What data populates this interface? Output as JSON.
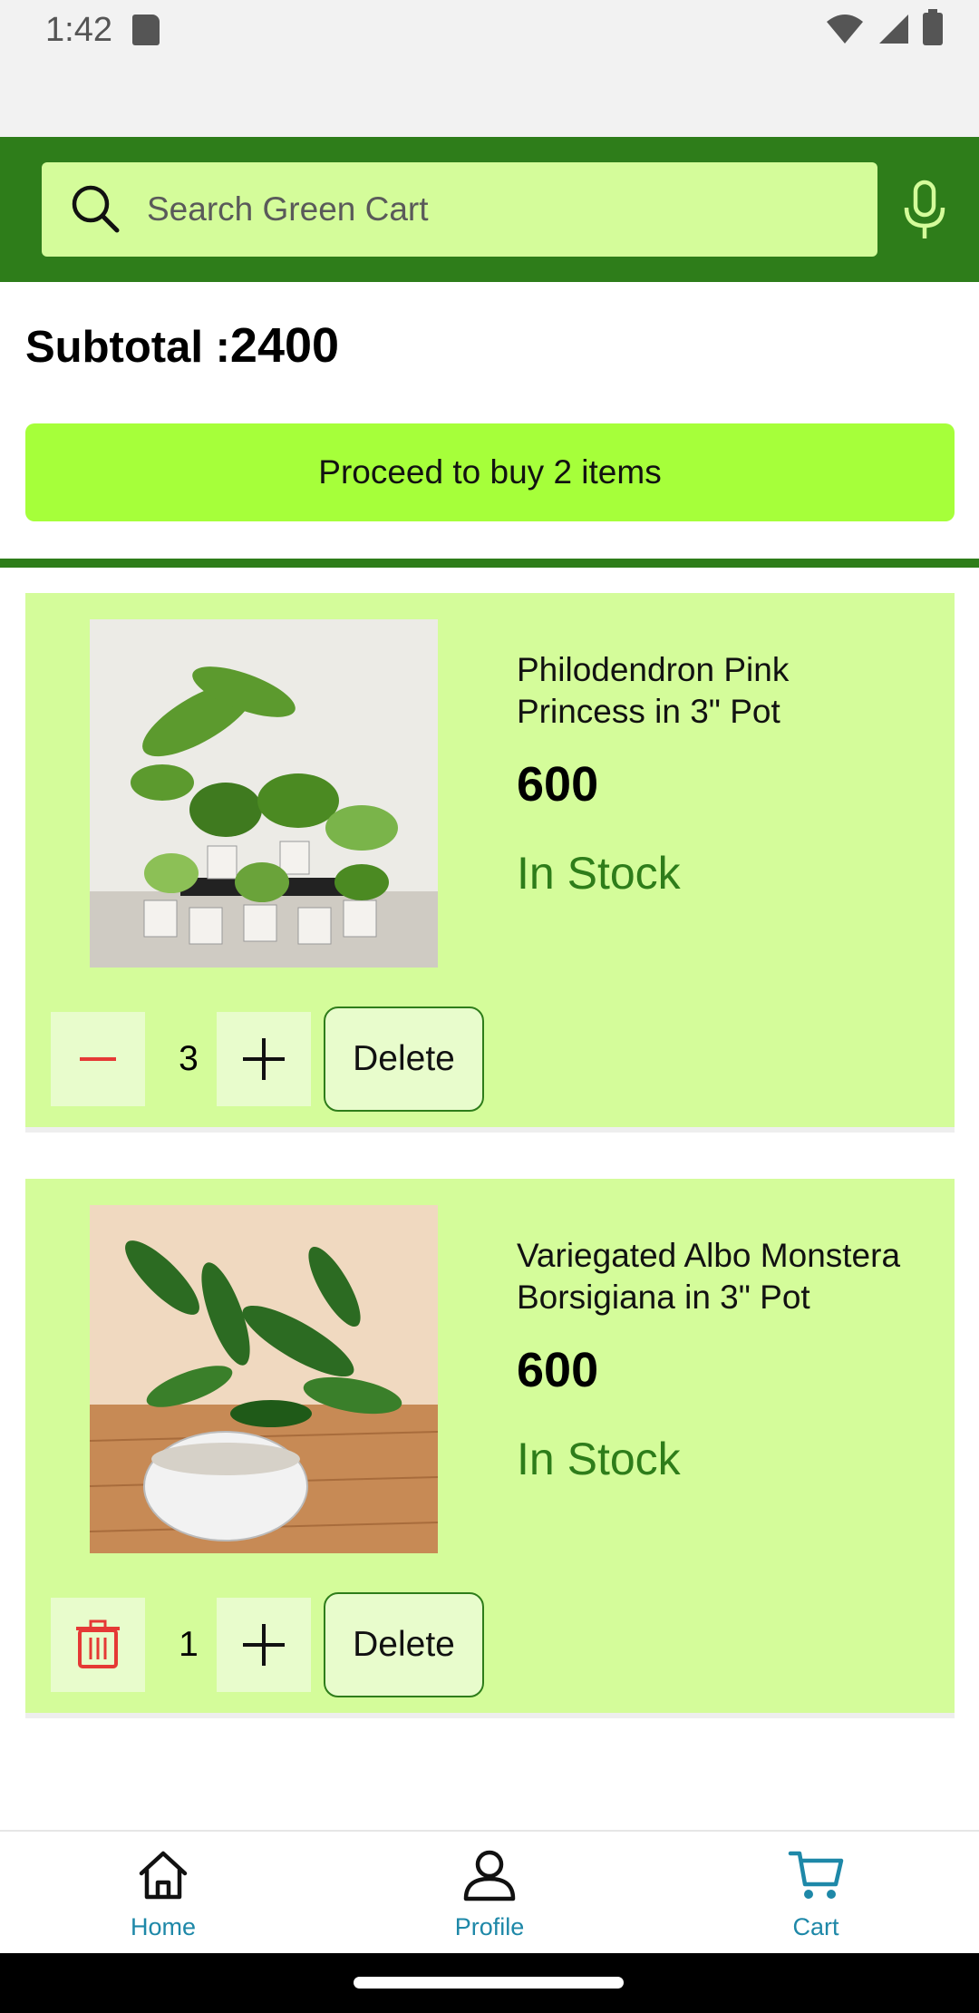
{
  "status": {
    "time": "1:42"
  },
  "search": {
    "placeholder": "Search Green Cart"
  },
  "cart": {
    "subtotal_label": "Subtotal :",
    "subtotal_value": "2400",
    "proceed_label": "Proceed to buy 2 items",
    "items": [
      {
        "name": "Philodendron Pink Princess in 3\" Pot",
        "price": "600",
        "stock": "In Stock",
        "quantity": "3",
        "delete_label": "Delete",
        "decrement_icon": "minus-icon",
        "image_desc": "group of potted plants"
      },
      {
        "name": "Variegated Albo Monstera Borsigiana in 3\" Pot",
        "price": "600",
        "stock": "In Stock",
        "quantity": "1",
        "delete_label": "Delete",
        "decrement_icon": "trash-icon",
        "image_desc": "zz plant in pot"
      }
    ]
  },
  "nav": {
    "home": "Home",
    "profile": "Profile",
    "cart": "Cart"
  },
  "colors": {
    "app_bar": "#2e7d1a",
    "search_bg": "#d4fc9a",
    "proceed_bg": "#a6ff3a",
    "card_bg": "#d4fc9a",
    "nav_active": "#1e88a8",
    "stock": "#2e7d1a"
  }
}
